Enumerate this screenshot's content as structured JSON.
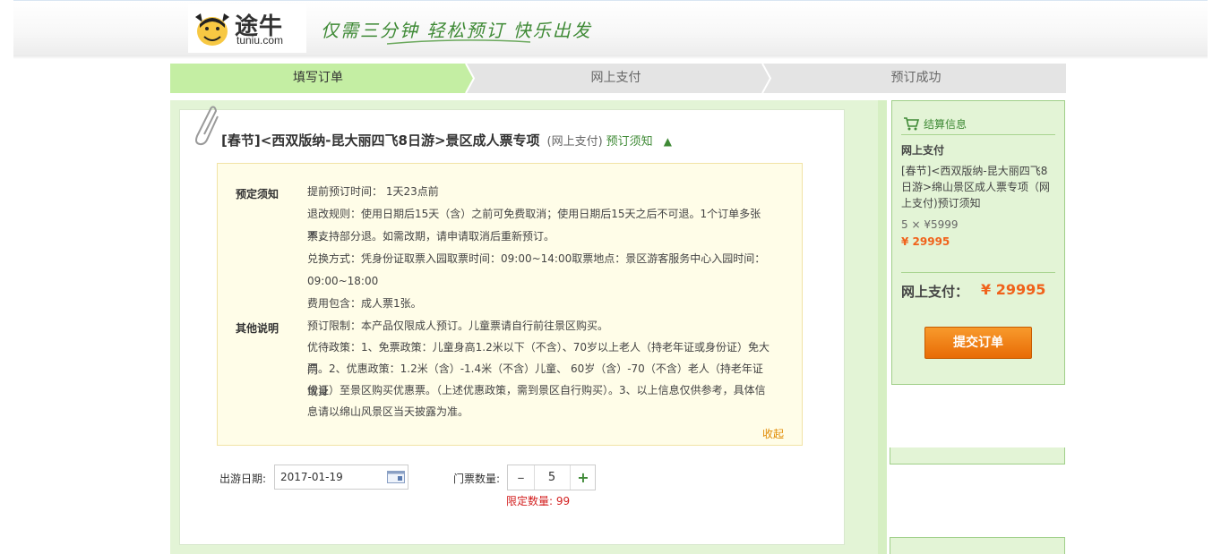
{
  "header": {
    "logo_cn": "途牛",
    "logo_en": "tuniu.com",
    "slogan": "仅需三分钟  轻松预订  快乐出发"
  },
  "steps": [
    {
      "label": "填写订单",
      "active": true
    },
    {
      "label": "网上支付",
      "active": false
    },
    {
      "label": "预订成功",
      "active": false
    }
  ],
  "product": {
    "title": "[春节]<西双版纳-昆大丽四飞8日游>景区成人票专项",
    "pay_type": "(网上支付)",
    "notice_link": "预订须知",
    "toggle_icon": "▲"
  },
  "notice": {
    "section1_label": "预定须知",
    "section2_label": "其他说明",
    "lines": [
      "提前预订时间： 1天23点前",
      "退改规则：使用日期后15天（含）之前可免费取消；使用日期后15天之后不可退。1个订单多张票，",
      "不支持部分退。如需改期，请申请取消后重新预订。",
      "兑换方式：凭身份证取票入园取票时间：09:00~14:00取票地点：景区游客服务中心入园时间：",
      "09:00~18:00",
      "费用包含：成人票1张。",
      "预订限制：本产品仅限成人预订。儿童票请自行前往景区购买。",
      "优待政策：1、免票政策：儿童身高1.2米以下（不含）、70岁以上老人（持老年证或身份证）免大门",
      "票。2、优惠政策：1.2米（含）-1.4米（不含）儿童、 60岁（含）-70（不含）老人（持老年证或身",
      "份证）至景区购买优惠票。（上述优惠政策，需到景区自行购买）。3、以上信息仅供参考，具体信",
      "息请以绵山风景区当天披露为准。"
    ],
    "collapse": "收起"
  },
  "form": {
    "date_label": "出游日期:",
    "date_value": "2017-01-19",
    "qty_label": "门票数量:",
    "qty_minus": "–",
    "qty_value": "5",
    "qty_plus": "+",
    "qty_limit": "限定数量: 99"
  },
  "sidebar": {
    "title": "结算信息",
    "pay_label": "网上支付",
    "product_desc": "[春节]<西双版纳-昆大丽四飞8日游>绵山景区成人票专项（网上支付)预订须知",
    "qty_price": "5 × ¥5999",
    "subtotal": "¥ 29995",
    "total_label": "网上支付：",
    "total_value": "¥ 29995",
    "submit_label": "提交订单"
  },
  "colors": {
    "brand_green": "#3f8a36",
    "step_active": "#c4eea3",
    "price_orange": "#f0621b",
    "button_orange": "#e86b05"
  }
}
